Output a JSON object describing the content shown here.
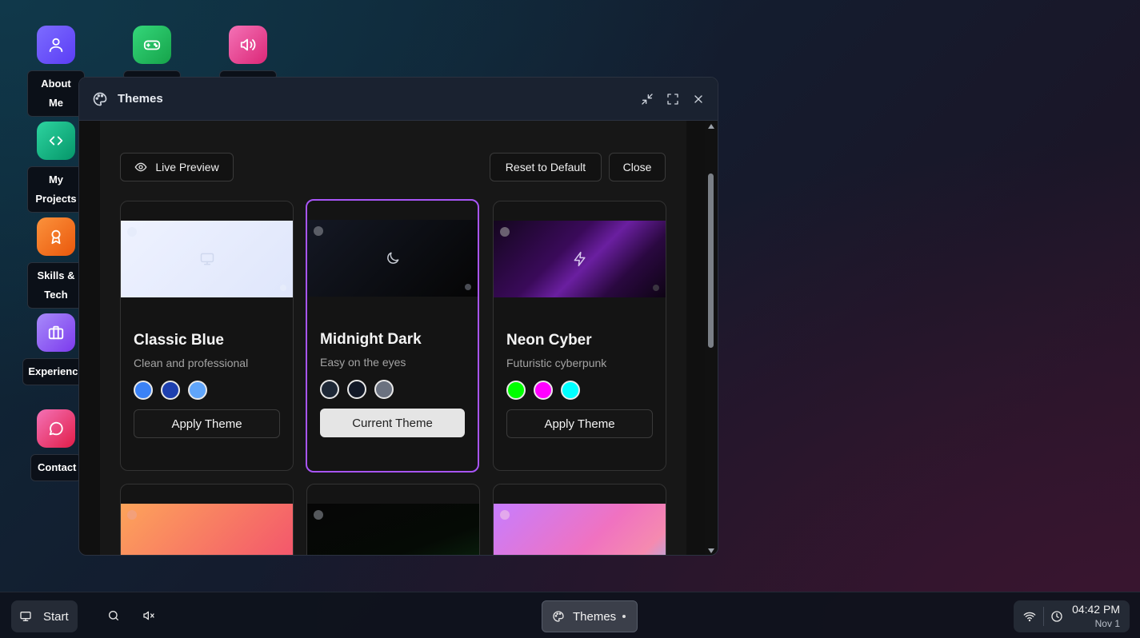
{
  "desktop": {
    "icons": [
      {
        "label": "About Me",
        "color": "#6d5dfc",
        "icon": "user-icon"
      },
      {
        "label": "",
        "color": "#22c55e",
        "icon": "gamepad-icon"
      },
      {
        "label": "",
        "color": "#ec4899",
        "icon": "volume-icon"
      },
      {
        "label": "My Projects",
        "color": "#10b981",
        "icon": "code-icon"
      },
      {
        "label": "Skills & Tech",
        "color": "#f97316",
        "icon": "award-icon"
      },
      {
        "label": "Experience",
        "color": "#8b5cf6",
        "icon": "briefcase-icon"
      },
      {
        "label": "Contact",
        "color": "#ec4899",
        "icon": "message-icon"
      }
    ]
  },
  "window": {
    "title": "Themes",
    "toolbar": {
      "live_preview": "Live Preview",
      "reset": "Reset to Default",
      "close": "Close"
    },
    "themes": [
      {
        "name": "Classic Blue",
        "description": "Clean and professional",
        "swatches": [
          "#3b82f6",
          "#1e40af",
          "#60a5fa"
        ],
        "button": "Apply Theme",
        "current": false,
        "icon": "monitor-icon"
      },
      {
        "name": "Midnight Dark",
        "description": "Easy on the eyes",
        "swatches": [
          "#1f2937",
          "#111827",
          "#6b7280"
        ],
        "button": "Current Theme",
        "current": true,
        "icon": "moon-icon"
      },
      {
        "name": "Neon Cyber",
        "description": "Futuristic cyberpunk",
        "swatches": [
          "#00ff00",
          "#ff00ff",
          "#00ffff"
        ],
        "button": "Apply Theme",
        "current": false,
        "icon": "zap-icon"
      },
      {
        "icon": "sun-icon"
      },
      {
        "icon": "eye-icon"
      },
      {
        "icon": "sparkles-icon"
      }
    ]
  },
  "taskbar": {
    "start": "Start",
    "active_app": "Themes",
    "time": "04:42 PM",
    "date": "Nov 1"
  }
}
